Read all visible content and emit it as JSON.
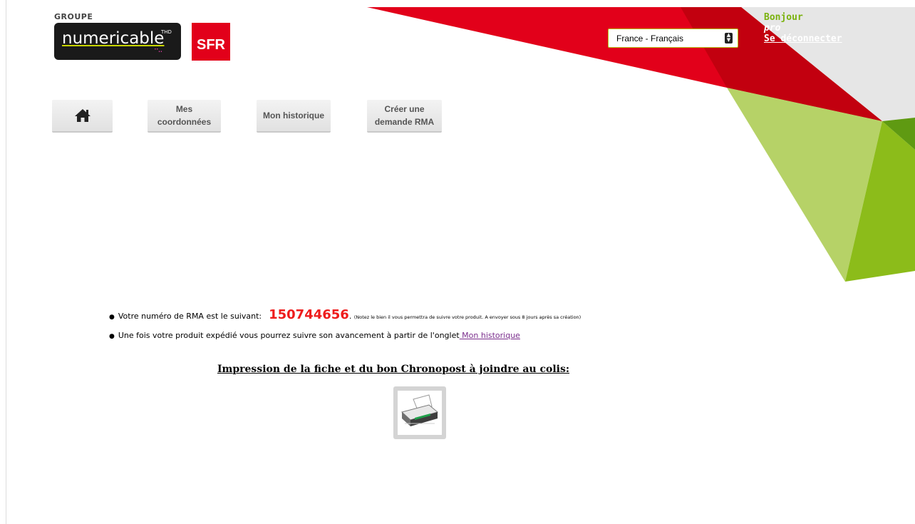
{
  "header": {
    "logo_group": "GROUPE",
    "logo_brand": "numericable",
    "logo_suffix": "THD",
    "logo_sfr": "SFR",
    "language": {
      "selected": "France - Français"
    },
    "user": {
      "greeting": "Bonjour",
      "name": "pro",
      "logout_label": "Se déconnecter"
    }
  },
  "nav": {
    "home_icon": "home-icon",
    "coordonnees_line1": "Mes",
    "coordonnees_line2": "coordonnées",
    "historique": "Mon historique",
    "rma_line1": "Créer une",
    "rma_line2": "demande RMA"
  },
  "content": {
    "rma_prefix": "Votre numéro de RMA est le suivant:",
    "rma_number": "150744656",
    "rma_dot": ".",
    "rma_note": "(Notez le bien il vous permettra de suivre votre produit. A envoyer sous 8 jours après sa création)",
    "tracking_text": "Une fois votre produit expédié vous pourrez suivre son avancement à partir de l'onglet",
    "tracking_link": " Mon historique",
    "print_title": "Impression de la fiche et du bon Chronopost à joindre au colis:",
    "print_icon": "printer-icon"
  },
  "colors": {
    "red": "#e2001a",
    "dark_red": "#c2000f",
    "light_green": "#b6d267",
    "green": "#8cbc1a",
    "gray": "#e6e6e6",
    "rma_red": "#ee1c1c",
    "link_purple": "#7a2d8c"
  }
}
